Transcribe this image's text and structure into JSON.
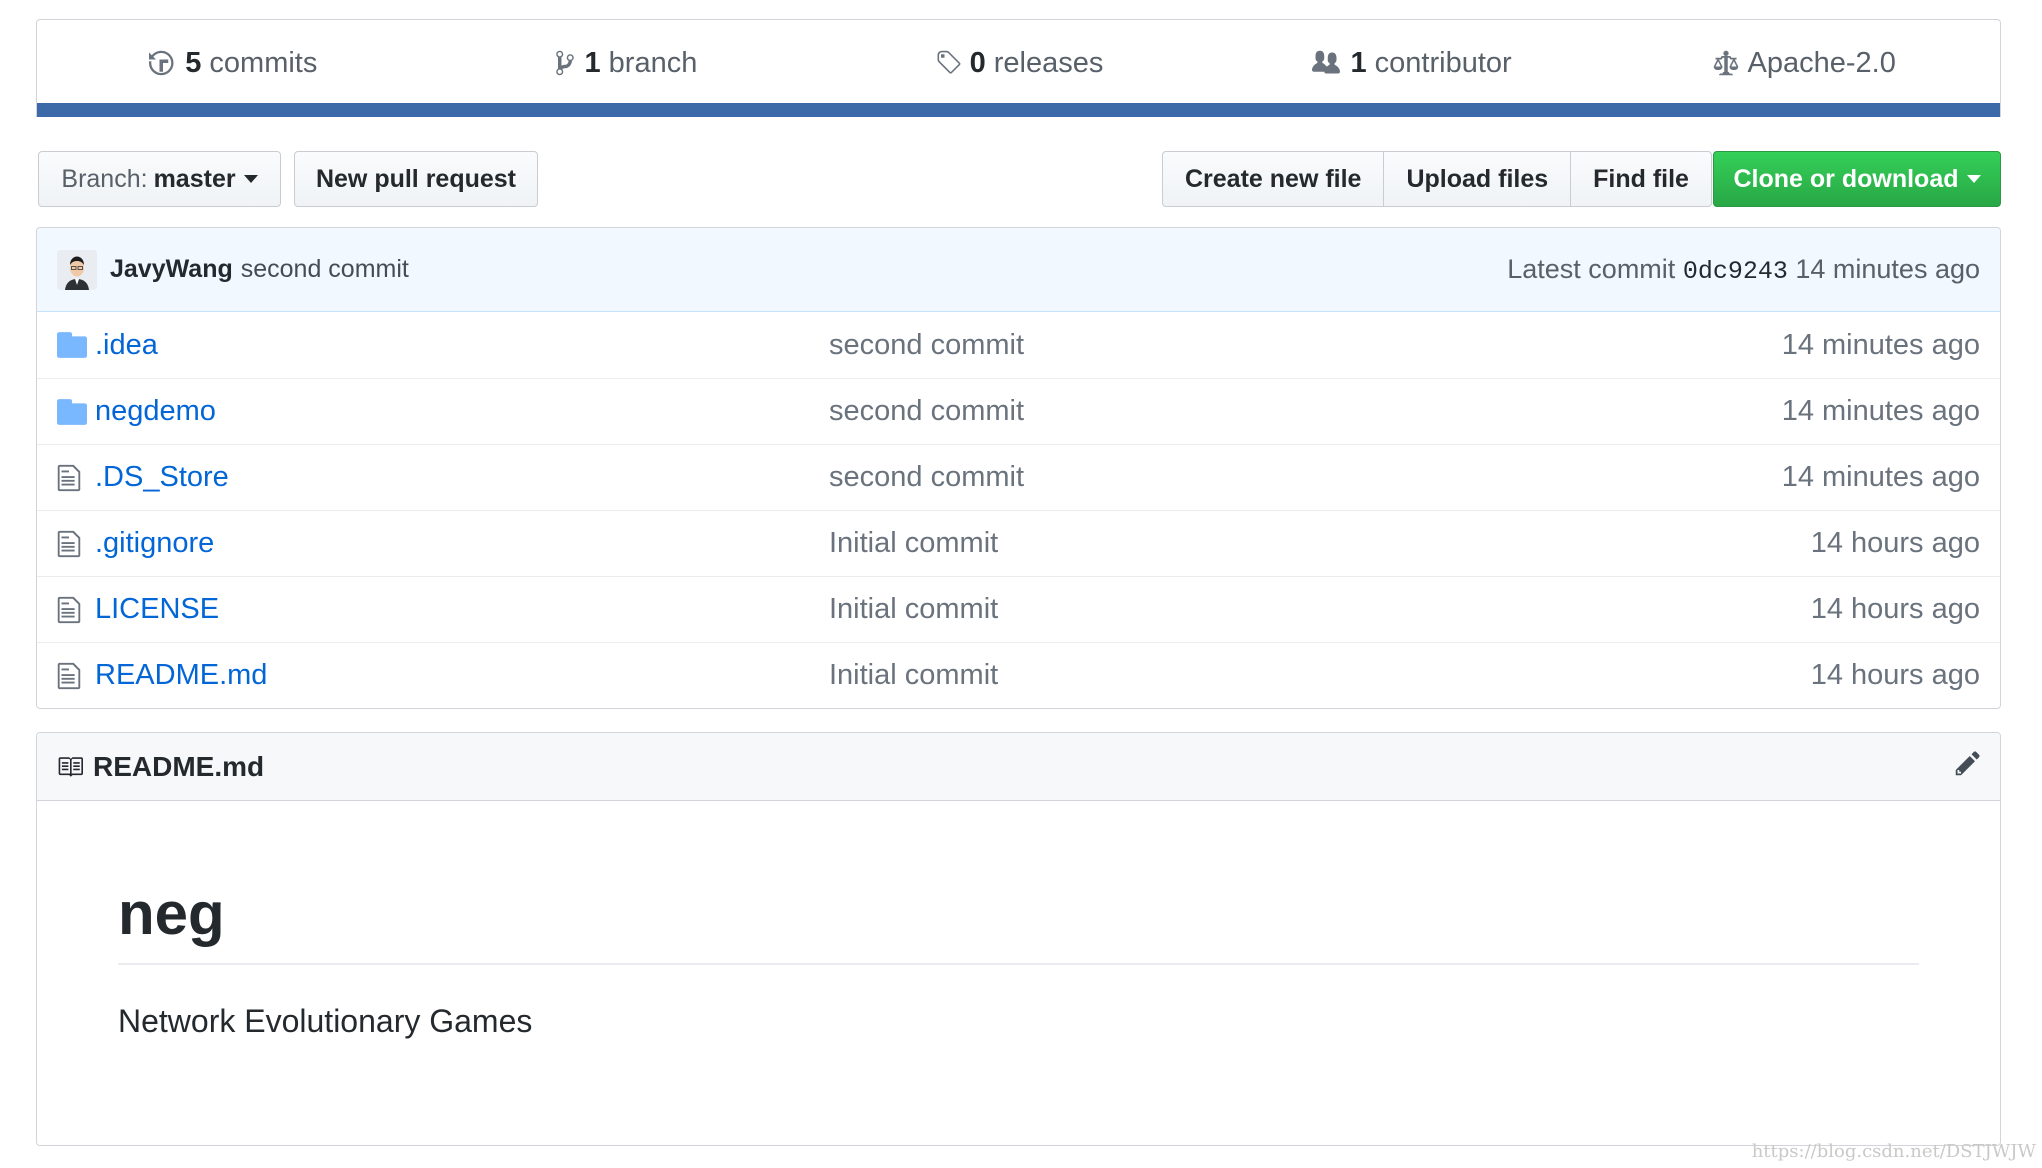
{
  "summary": {
    "commits": {
      "count": "5",
      "label": "commits",
      "icon": "history-icon"
    },
    "branches": {
      "count": "1",
      "label": "branch",
      "icon": "git-branch-icon"
    },
    "releases": {
      "count": "0",
      "label": "releases",
      "icon": "tag-icon"
    },
    "contributors": {
      "count": "1",
      "label": "contributor",
      "icon": "people-icon"
    },
    "license": {
      "label": "Apache-2.0",
      "icon": "law-icon"
    },
    "language_bar_color": "#3c6aa8"
  },
  "toolbar": {
    "branch_prefix": "Branch:",
    "branch_name": "master",
    "new_pull_request": "New pull request",
    "create_new_file": "Create new file",
    "upload_files": "Upload files",
    "find_file": "Find file",
    "clone_or_download": "Clone or download",
    "clone_color": "#28a745"
  },
  "latest_commit": {
    "author": "JavyWang",
    "message": "second commit",
    "prefix": "Latest commit",
    "sha": "0dc9243",
    "age": "14 minutes ago"
  },
  "files": [
    {
      "name": ".idea",
      "type": "folder",
      "message": "second commit",
      "age": "14 minutes ago"
    },
    {
      "name": "negdemo",
      "type": "folder",
      "message": "second commit",
      "age": "14 minutes ago"
    },
    {
      "name": ".DS_Store",
      "type": "file",
      "message": "second commit",
      "age": "14 minutes ago"
    },
    {
      "name": ".gitignore",
      "type": "file",
      "message": "Initial commit",
      "age": "14 hours ago"
    },
    {
      "name": "LICENSE",
      "type": "file",
      "message": "Initial commit",
      "age": "14 hours ago"
    },
    {
      "name": "README.md",
      "type": "file",
      "message": "Initial commit",
      "age": "14 hours ago"
    }
  ],
  "readme": {
    "filename": "README.md",
    "title": "neg",
    "description": "Network Evolutionary Games"
  },
  "watermark": "https://blog.csdn.net/DSTJWJW"
}
